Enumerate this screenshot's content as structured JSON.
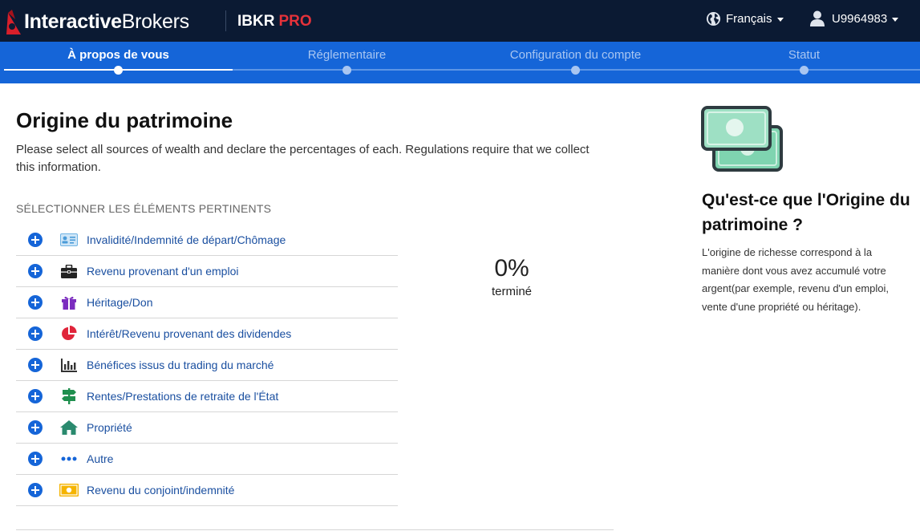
{
  "header": {
    "logo_bold": "Interactive",
    "logo_regular": "Brokers",
    "product_name": "IBKR",
    "product_tier": "PRO",
    "language": "Français",
    "account_id": "U9964983",
    "colors": {
      "bar": "#0b1a33",
      "accent_red": "#e5323a"
    }
  },
  "steps": [
    {
      "label": "À propos de vous",
      "active": true
    },
    {
      "label": "Réglementaire",
      "active": false
    },
    {
      "label": "Configuration du compte",
      "active": false
    },
    {
      "label": "Statut",
      "active": false
    }
  ],
  "main": {
    "title": "Origine du patrimoine",
    "intro": "Please select all sources of wealth and declare the percentages of each. Regulations require that we collect this information.",
    "section_label": "SÉLECTIONNER LES ÉLÉMENTS PERTINENTS",
    "items": [
      {
        "label": "Invalidité/Indemnité de départ/Chômage",
        "icon": "id-card-icon"
      },
      {
        "label": "Revenu provenant d'un emploi",
        "icon": "briefcase-icon"
      },
      {
        "label": "Héritage/Don",
        "icon": "gift-icon"
      },
      {
        "label": "Intérêt/Revenu provenant des dividendes",
        "icon": "pie-chart-icon"
      },
      {
        "label": "Bénéfices issus du trading du marché",
        "icon": "bar-chart-icon"
      },
      {
        "label": "Rentes/Prestations de retraite de l'État",
        "icon": "signpost-icon"
      },
      {
        "label": "Propriété",
        "icon": "house-icon"
      },
      {
        "label": "Autre",
        "icon": "ellipsis-icon"
      },
      {
        "label": "Revenu du conjoint/indemnité",
        "icon": "banknote-icon"
      }
    ],
    "progress_value": "0%",
    "progress_label": "terminé",
    "progress_fraction": 0
  },
  "sidebar": {
    "icon": "money-bills-icon",
    "title": "Qu'est-ce que l'Origine du patrimoine ?",
    "text": "L'origine de richesse correspond à la manière dont vous avez accumulé votre argent(par exemple, revenu d'un emploi, vente d'une propriété ou héritage)."
  },
  "colors": {
    "primary_blue": "#1565d8",
    "link_blue": "#1a4fa0"
  }
}
